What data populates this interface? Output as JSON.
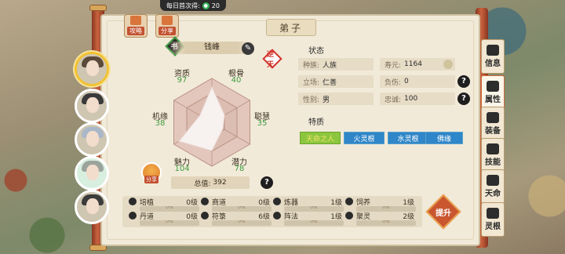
{
  "header": {
    "daily_label": "每日首次得:",
    "daily_value": "20"
  },
  "top_buttons": [
    {
      "label": "攻略"
    },
    {
      "label": "分享"
    }
  ],
  "title": "弟子",
  "name": "钱峰",
  "badges": {
    "left": "书",
    "right": "逆天"
  },
  "stats": {
    "zizhi": {
      "label": "资质",
      "value": "97"
    },
    "gengu": {
      "label": "根骨",
      "value": "40"
    },
    "jiyuan": {
      "label": "机缘",
      "value": "38"
    },
    "conghui": {
      "label": "聪慧",
      "value": "35"
    },
    "meili": {
      "label": "魅力",
      "value": "104"
    },
    "qianli": {
      "label": "潜力",
      "value": "78"
    }
  },
  "radar": {
    "axes": [
      "资质",
      "根骨",
      "聪慧",
      "潜力",
      "魅力",
      "机缘"
    ],
    "max": 120,
    "values": [
      97,
      40,
      35,
      78,
      104,
      38
    ]
  },
  "total": {
    "label": "总值:",
    "value": "392"
  },
  "share_round": "分享",
  "status": {
    "heading": "状态",
    "race": {
      "label": "种族:",
      "value": "人族"
    },
    "lifespan": {
      "label": "寿元:",
      "value": "1164"
    },
    "stance": {
      "label": "立场:",
      "value": "仁善"
    },
    "injury": {
      "label": "负伤:",
      "value": "0"
    },
    "gender": {
      "label": "性别:",
      "value": "男"
    },
    "loyalty": {
      "label": "忠诚:",
      "value": "100"
    }
  },
  "traits": {
    "heading": "特质",
    "items": [
      "天命之人",
      "火灵根",
      "水灵根",
      "佛缘"
    ]
  },
  "skills": [
    {
      "name": "培植",
      "level": "0级",
      "pct": "0%"
    },
    {
      "name": "商道",
      "level": "0级",
      "pct": "0%"
    },
    {
      "name": "炼器",
      "level": "1级",
      "pct": "0%"
    },
    {
      "name": "饲养",
      "level": "1级",
      "pct": "0%"
    },
    {
      "name": "丹道",
      "level": "0级",
      "pct": "0%"
    },
    {
      "name": "符箓",
      "level": "6级",
      "pct": "0%"
    },
    {
      "name": "阵法",
      "level": "1级",
      "pct": "0%"
    },
    {
      "name": "聚灵",
      "level": "2级",
      "pct": "0%"
    }
  ],
  "ascend": "提升",
  "tabs": [
    {
      "label": "信息"
    },
    {
      "label": "属性"
    },
    {
      "label": "装备"
    },
    {
      "label": "技能"
    },
    {
      "label": "天命"
    },
    {
      "label": "灵根"
    }
  ],
  "colors": {
    "accent": "#c2502f",
    "green_stat": "#3e9b3e",
    "trait_green": "#8cc63f",
    "trait_blue": "#2f86c8"
  }
}
